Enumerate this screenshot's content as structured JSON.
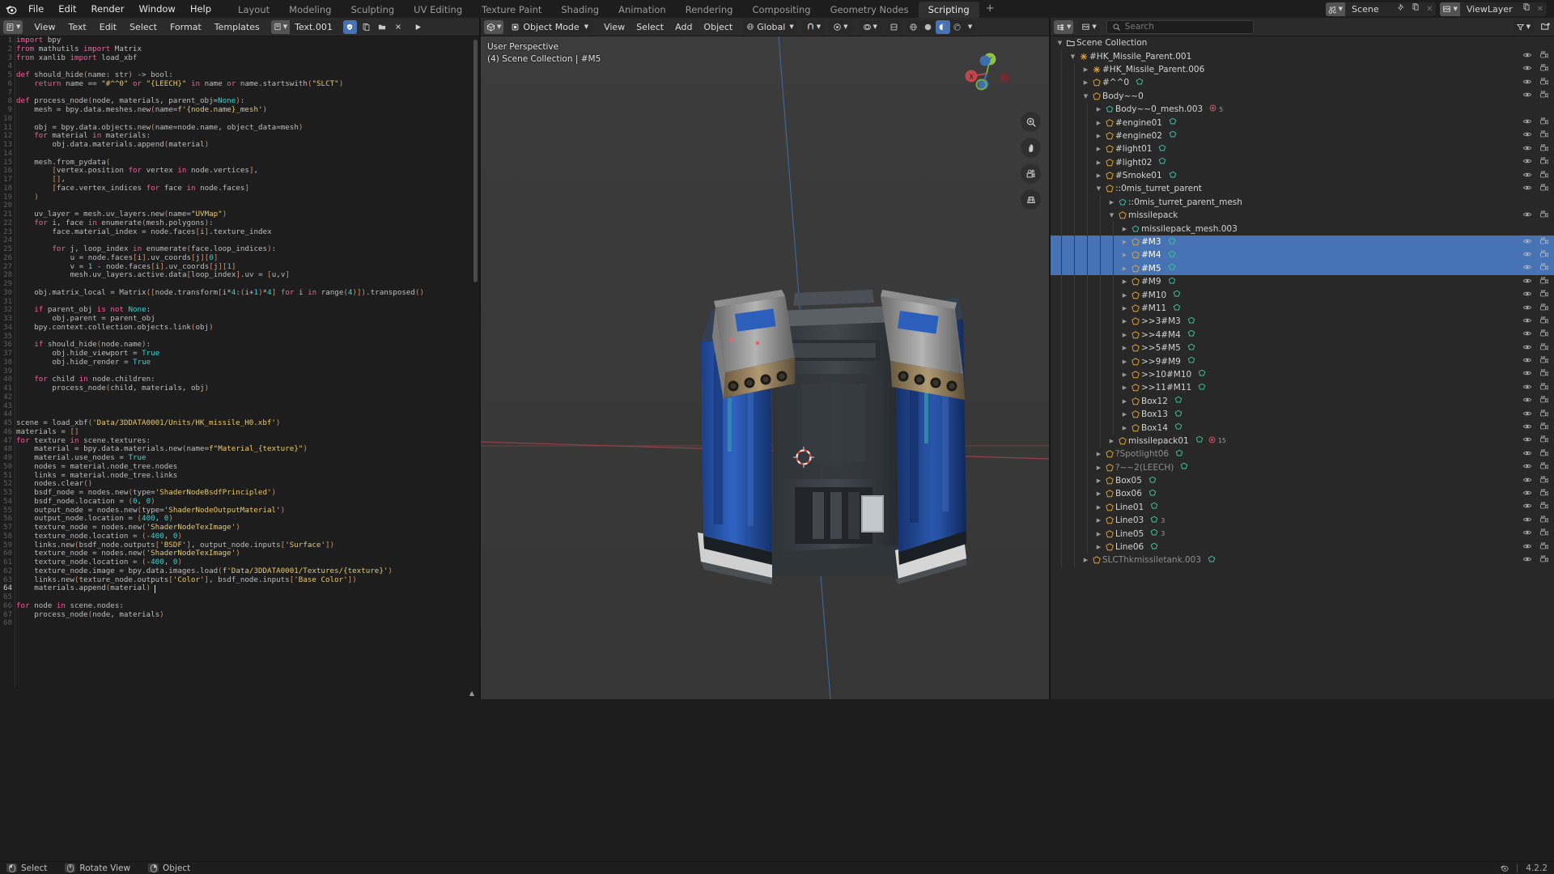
{
  "topbar": {
    "logo_icon": "blender-logo-icon",
    "menus": [
      "File",
      "Edit",
      "Render",
      "Window",
      "Help"
    ],
    "workspace_tabs": [
      {
        "label": "Layout",
        "active": false
      },
      {
        "label": "Modeling",
        "active": false
      },
      {
        "label": "Sculpting",
        "active": false
      },
      {
        "label": "UV Editing",
        "active": false
      },
      {
        "label": "Texture Paint",
        "active": false
      },
      {
        "label": "Shading",
        "active": false
      },
      {
        "label": "Animation",
        "active": false
      },
      {
        "label": "Rendering",
        "active": false
      },
      {
        "label": "Compositing",
        "active": false
      },
      {
        "label": "Geometry Nodes",
        "active": false
      },
      {
        "label": "Scripting",
        "active": true
      }
    ],
    "add_workspace_label": "+",
    "scene_name": "Scene",
    "viewlayer_name": "ViewLayer",
    "scene_icons": [
      "scene-icon",
      "pin-icon",
      "new-scene-icon",
      "delete-scene-icon"
    ],
    "viewlayer_icons": [
      "viewlayer-icon",
      "new-viewlayer-icon",
      "delete-viewlayer-icon"
    ]
  },
  "text_editor": {
    "editor_type_icon": "text-editor-icon",
    "menus": [
      "View",
      "Text",
      "Edit",
      "Select",
      "Format",
      "Templates"
    ],
    "datablock_name": "Text.001",
    "buttons": [
      {
        "name": "register-toggle",
        "icon": "shield-icon",
        "active": true
      },
      {
        "name": "new-text-button",
        "icon": "new-file-icon",
        "active": false
      },
      {
        "name": "open-text-button",
        "icon": "folder-icon",
        "active": false
      },
      {
        "name": "unlink-text-button",
        "icon": "close-icon",
        "active": false
      },
      {
        "name": "run-script-button",
        "icon": "play-icon",
        "active": false
      }
    ],
    "code_lines": [
      {
        "n": 1,
        "t": "import bpy"
      },
      {
        "n": 2,
        "t": "from mathutils import Matrix"
      },
      {
        "n": 3,
        "t": "from xanlib import load_xbf"
      },
      {
        "n": 4,
        "t": ""
      },
      {
        "n": 5,
        "t": "def should_hide(name: str) -> bool:"
      },
      {
        "n": 6,
        "t": "    return name == \"#^^0\" or \"{LEECH}\" in name or name.startswith(\"SLCT\")"
      },
      {
        "n": 7,
        "t": ""
      },
      {
        "n": 8,
        "t": "def process_node(node, materials, parent_obj=None):"
      },
      {
        "n": 9,
        "t": "    mesh = bpy.data.meshes.new(name=f'{node.name}_mesh')"
      },
      {
        "n": 10,
        "t": ""
      },
      {
        "n": 11,
        "t": "    obj = bpy.data.objects.new(name=node.name, object_data=mesh)"
      },
      {
        "n": 12,
        "t": "    for material in materials:"
      },
      {
        "n": 13,
        "t": "        obj.data.materials.append(material)"
      },
      {
        "n": 14,
        "t": ""
      },
      {
        "n": 15,
        "t": "    mesh.from_pydata("
      },
      {
        "n": 16,
        "t": "        [vertex.position for vertex in node.vertices],"
      },
      {
        "n": 17,
        "t": "        [],"
      },
      {
        "n": 18,
        "t": "        [face.vertex_indices for face in node.faces]"
      },
      {
        "n": 19,
        "t": "    )"
      },
      {
        "n": 20,
        "t": ""
      },
      {
        "n": 21,
        "t": "    uv_layer = mesh.uv_layers.new(name=\"UVMap\")"
      },
      {
        "n": 22,
        "t": "    for i, face in enumerate(mesh.polygons):"
      },
      {
        "n": 23,
        "t": "        face.material_index = node.faces[i].texture_index"
      },
      {
        "n": 24,
        "t": ""
      },
      {
        "n": 25,
        "t": "        for j, loop_index in enumerate(face.loop_indices):"
      },
      {
        "n": 26,
        "t": "            u = node.faces[i].uv_coords[j][0]"
      },
      {
        "n": 27,
        "t": "            v = 1 - node.faces[i].uv_coords[j][1]"
      },
      {
        "n": 28,
        "t": "            mesh.uv_layers.active.data[loop_index].uv = [u,v]"
      },
      {
        "n": 29,
        "t": ""
      },
      {
        "n": 30,
        "t": "    obj.matrix_local = Matrix([node.transform[i*4:(i+1)*4] for i in range(4)]).transposed()"
      },
      {
        "n": 31,
        "t": ""
      },
      {
        "n": 32,
        "t": "    if parent_obj is not None:"
      },
      {
        "n": 33,
        "t": "        obj.parent = parent_obj"
      },
      {
        "n": 34,
        "t": "    bpy.context.collection.objects.link(obj)"
      },
      {
        "n": 35,
        "t": ""
      },
      {
        "n": 36,
        "t": "    if should_hide(node.name):"
      },
      {
        "n": 37,
        "t": "        obj.hide_viewport = True"
      },
      {
        "n": 38,
        "t": "        obj.hide_render = True"
      },
      {
        "n": 39,
        "t": ""
      },
      {
        "n": 40,
        "t": "    for child in node.children:"
      },
      {
        "n": 41,
        "t": "        process_node(child, materials, obj)"
      },
      {
        "n": 42,
        "t": ""
      },
      {
        "n": 43,
        "t": ""
      },
      {
        "n": 44,
        "t": ""
      },
      {
        "n": 45,
        "t": "scene = load_xbf('Data/3DDATA0001/Units/HK_missile_H0.xbf')"
      },
      {
        "n": 46,
        "t": "materials = []"
      },
      {
        "n": 47,
        "t": "for texture in scene.textures:"
      },
      {
        "n": 48,
        "t": "    material = bpy.data.materials.new(name=f\"Material_{texture}\")"
      },
      {
        "n": 49,
        "t": "    material.use_nodes = True"
      },
      {
        "n": 50,
        "t": "    nodes = material.node_tree.nodes"
      },
      {
        "n": 51,
        "t": "    links = material.node_tree.links"
      },
      {
        "n": 52,
        "t": "    nodes.clear()"
      },
      {
        "n": 53,
        "t": "    bsdf_node = nodes.new(type='ShaderNodeBsdfPrincipled')"
      },
      {
        "n": 54,
        "t": "    bsdf_node.location = (0, 0)"
      },
      {
        "n": 55,
        "t": "    output_node = nodes.new(type='ShaderNodeOutputMaterial')"
      },
      {
        "n": 56,
        "t": "    output_node.location = (400, 0)"
      },
      {
        "n": 57,
        "t": "    texture_node = nodes.new('ShaderNodeTexImage')"
      },
      {
        "n": 58,
        "t": "    texture_node.location = (-400, 0)"
      },
      {
        "n": 59,
        "t": "    links.new(bsdf_node.outputs['BSDF'], output_node.inputs['Surface'])"
      },
      {
        "n": 60,
        "t": "    texture_node = nodes.new('ShaderNodeTexImage')"
      },
      {
        "n": 61,
        "t": "    texture_node.location = (-400, 0)"
      },
      {
        "n": 62,
        "t": "    texture_node.image = bpy.data.images.load(f'Data/3DDATA0001/Textures/{texture}')"
      },
      {
        "n": 63,
        "t": "    links.new(texture_node.outputs['Color'], bsdf_node.inputs['Base Color'])"
      },
      {
        "n": 64,
        "t": "    materials.append(material)"
      },
      {
        "n": 65,
        "t": ""
      },
      {
        "n": 66,
        "t": "for node in scene.nodes:"
      },
      {
        "n": 67,
        "t": "    process_node(node, materials)"
      },
      {
        "n": 68,
        "t": ""
      }
    ],
    "cursor_line": 64
  },
  "viewport": {
    "editor_type_icon": "3d-viewport-icon",
    "mode": "Object Mode",
    "menus": [
      "View",
      "Select",
      "Add",
      "Object"
    ],
    "transform_orientation": "Global",
    "snap_icon": "magnet-icon",
    "proportional_icon": "proportional-edit-icon",
    "overlay_icon": "overlays-icon",
    "xray_icon": "xray-icon",
    "shading_modes": [
      "wireframe",
      "solid",
      "material-preview",
      "rendered"
    ],
    "active_shading": "material-preview",
    "overlay_line1": "User Perspective",
    "overlay_line2": "(4) Scene Collection | #M5",
    "gizmo_axes": [
      "X",
      "Y",
      "Z"
    ],
    "nav_tools": [
      "zoom-icon",
      "hand-icon",
      "camera-icon",
      "grid-icon"
    ]
  },
  "outliner": {
    "display_mode_icon": "outliner-display-mode-icon",
    "filter_datablock_icon": "scene-datablock-icon",
    "search_placeholder": "Search",
    "filter_icon": "filter-icon",
    "new_collection_icon": "new-collection-icon",
    "root_label": "Scene Collection",
    "rows": [
      {
        "depth": 0,
        "tri": "down",
        "icon": "collection-icon",
        "label": "Scene Collection",
        "eye": false,
        "cam": false
      },
      {
        "depth": 1,
        "tri": "down",
        "icon": "object-empty-icon",
        "label": "#HK_Missile_Parent.001",
        "eye": true,
        "cam": true
      },
      {
        "depth": 2,
        "tri": "right",
        "icon": "object-empty-icon",
        "label": "#HK_Missile_Parent.006",
        "eye": true,
        "cam": true
      },
      {
        "depth": 2,
        "tri": "right",
        "icon": "mesh-icon",
        "label": "#^^0",
        "eye": true,
        "cam": true,
        "extra": [
          "mesh-data-icon"
        ]
      },
      {
        "depth": 2,
        "tri": "down",
        "icon": "mesh-icon",
        "label": "Body~~0",
        "eye": true,
        "cam": true
      },
      {
        "depth": 3,
        "tri": "right",
        "icon": "mesh-data-icon",
        "label": "Body~~0_mesh.003",
        "eye": false,
        "cam": false,
        "badge": "5",
        "extra": [
          "material-icon"
        ]
      },
      {
        "depth": 3,
        "tri": "right",
        "icon": "mesh-icon",
        "label": "#engine01",
        "eye": true,
        "cam": true,
        "extra": [
          "mesh-data-icon"
        ]
      },
      {
        "depth": 3,
        "tri": "right",
        "icon": "mesh-icon",
        "label": "#engine02",
        "eye": true,
        "cam": true,
        "extra": [
          "mesh-data-icon"
        ]
      },
      {
        "depth": 3,
        "tri": "right",
        "icon": "mesh-icon",
        "label": "#light01",
        "eye": true,
        "cam": true,
        "extra": [
          "mesh-data-icon"
        ]
      },
      {
        "depth": 3,
        "tri": "right",
        "icon": "mesh-icon",
        "label": "#light02",
        "eye": true,
        "cam": true,
        "extra": [
          "mesh-data-icon"
        ]
      },
      {
        "depth": 3,
        "tri": "right",
        "icon": "mesh-icon",
        "label": "#Smoke01",
        "eye": true,
        "cam": true,
        "extra": [
          "mesh-data-icon"
        ]
      },
      {
        "depth": 3,
        "tri": "down",
        "icon": "mesh-icon",
        "label": "::0mis_turret_parent",
        "eye": true,
        "cam": true
      },
      {
        "depth": 4,
        "tri": "right",
        "icon": "mesh-data-icon",
        "label": "::0mis_turret_parent_mesh",
        "eye": false,
        "cam": false
      },
      {
        "depth": 4,
        "tri": "down",
        "icon": "mesh-icon",
        "label": "missilepack",
        "eye": true,
        "cam": true
      },
      {
        "depth": 5,
        "tri": "right",
        "icon": "mesh-data-icon",
        "label": "missilepack_mesh.003",
        "eye": false,
        "cam": false
      },
      {
        "depth": 5,
        "tri": "right",
        "icon": "mesh-icon",
        "label": "#M3",
        "eye": true,
        "cam": true,
        "selected": true,
        "extra": [
          "mesh-data-icon"
        ]
      },
      {
        "depth": 5,
        "tri": "right",
        "icon": "mesh-icon",
        "label": "#M4",
        "eye": true,
        "cam": true,
        "selected": true,
        "extra": [
          "mesh-data-icon"
        ]
      },
      {
        "depth": 5,
        "tri": "right",
        "icon": "mesh-icon",
        "label": "#M5",
        "eye": true,
        "cam": true,
        "selected": true,
        "active": true,
        "extra": [
          "mesh-data-icon"
        ]
      },
      {
        "depth": 5,
        "tri": "right",
        "icon": "mesh-icon",
        "label": "#M9",
        "eye": true,
        "cam": true,
        "extra": [
          "mesh-data-icon"
        ]
      },
      {
        "depth": 5,
        "tri": "right",
        "icon": "mesh-icon",
        "label": "#M10",
        "eye": true,
        "cam": true,
        "extra": [
          "mesh-data-icon"
        ]
      },
      {
        "depth": 5,
        "tri": "right",
        "icon": "mesh-icon",
        "label": "#M11",
        "eye": true,
        "cam": true,
        "extra": [
          "mesh-data-icon"
        ]
      },
      {
        "depth": 5,
        "tri": "right",
        "icon": "mesh-icon",
        "label": ">>3#M3",
        "eye": true,
        "cam": true,
        "extra": [
          "mesh-data-icon"
        ]
      },
      {
        "depth": 5,
        "tri": "right",
        "icon": "mesh-icon",
        "label": ">>4#M4",
        "eye": true,
        "cam": true,
        "extra": [
          "mesh-data-icon"
        ]
      },
      {
        "depth": 5,
        "tri": "right",
        "icon": "mesh-icon",
        "label": ">>5#M5",
        "eye": true,
        "cam": true,
        "extra": [
          "mesh-data-icon"
        ]
      },
      {
        "depth": 5,
        "tri": "right",
        "icon": "mesh-icon",
        "label": ">>9#M9",
        "eye": true,
        "cam": true,
        "extra": [
          "mesh-data-icon"
        ]
      },
      {
        "depth": 5,
        "tri": "right",
        "icon": "mesh-icon",
        "label": ">>10#M10",
        "eye": true,
        "cam": true,
        "extra": [
          "mesh-data-icon"
        ]
      },
      {
        "depth": 5,
        "tri": "right",
        "icon": "mesh-icon",
        "label": ">>11#M11",
        "eye": true,
        "cam": true,
        "extra": [
          "mesh-data-icon"
        ]
      },
      {
        "depth": 5,
        "tri": "right",
        "icon": "mesh-icon",
        "label": "Box12",
        "eye": true,
        "cam": true,
        "extra": [
          "mesh-data-icon"
        ]
      },
      {
        "depth": 5,
        "tri": "right",
        "icon": "mesh-icon",
        "label": "Box13",
        "eye": true,
        "cam": true,
        "extra": [
          "mesh-data-icon"
        ]
      },
      {
        "depth": 5,
        "tri": "right",
        "icon": "mesh-icon",
        "label": "Box14",
        "eye": true,
        "cam": true,
        "extra": [
          "mesh-data-icon"
        ]
      },
      {
        "depth": 4,
        "tri": "right",
        "icon": "mesh-icon",
        "label": "missilepack01",
        "eye": true,
        "cam": true,
        "badge": "15",
        "extra": [
          "mesh-data-icon",
          "material-icon"
        ]
      },
      {
        "depth": 3,
        "tri": "right",
        "icon": "mesh-icon",
        "label": "?Spotlight06",
        "eye": true,
        "cam": true,
        "dim": true,
        "extra": [
          "mesh-data-icon"
        ]
      },
      {
        "depth": 3,
        "tri": "right",
        "icon": "mesh-icon",
        "label": "?~~2(LEECH)",
        "eye": true,
        "cam": true,
        "dim": true,
        "extra": [
          "mesh-data-icon"
        ]
      },
      {
        "depth": 3,
        "tri": "right",
        "icon": "mesh-icon",
        "label": "Box05",
        "eye": true,
        "cam": true,
        "extra": [
          "mesh-data-icon"
        ]
      },
      {
        "depth": 3,
        "tri": "right",
        "icon": "mesh-icon",
        "label": "Box06",
        "eye": true,
        "cam": true,
        "extra": [
          "mesh-data-icon"
        ]
      },
      {
        "depth": 3,
        "tri": "right",
        "icon": "mesh-icon",
        "label": "Line01",
        "eye": true,
        "cam": true,
        "extra": [
          "mesh-data-icon"
        ]
      },
      {
        "depth": 3,
        "tri": "right",
        "icon": "mesh-icon",
        "label": "Line03",
        "eye": true,
        "cam": true,
        "badge": "3",
        "extra": [
          "mesh-data-icon"
        ]
      },
      {
        "depth": 3,
        "tri": "right",
        "icon": "mesh-icon",
        "label": "Line05",
        "eye": true,
        "cam": true,
        "badge": "3",
        "extra": [
          "mesh-data-icon"
        ]
      },
      {
        "depth": 3,
        "tri": "right",
        "icon": "mesh-icon",
        "label": "Line06",
        "eye": true,
        "cam": true,
        "extra": [
          "mesh-data-icon"
        ]
      },
      {
        "depth": 2,
        "tri": "right",
        "icon": "mesh-icon",
        "label": "SLCThkmissiletank.003",
        "eye": true,
        "cam": true,
        "dim": true,
        "extra": [
          "mesh-data-icon"
        ]
      }
    ]
  },
  "statusbar": {
    "items": [
      {
        "key_icon": "mouse-left-icon",
        "label": "Select"
      },
      {
        "key_icon": "mouse-middle-icon",
        "label": "Rotate View"
      },
      {
        "key_icon": "mouse-right-icon",
        "label": "Object"
      }
    ],
    "version": "4.2.2",
    "separator": "|",
    "blender_icon": "blender-mini-icon"
  },
  "colors": {
    "accent_blue": "#4772b3",
    "editor_bg": "#1d1d1d",
    "header_bg": "#2b2b2b",
    "outliner_bg": "#282828",
    "viewport_bg": "#393939",
    "axis_x": "#c1474b",
    "axis_y": "#8bc34a",
    "axis_z": "#3e7ec4"
  }
}
